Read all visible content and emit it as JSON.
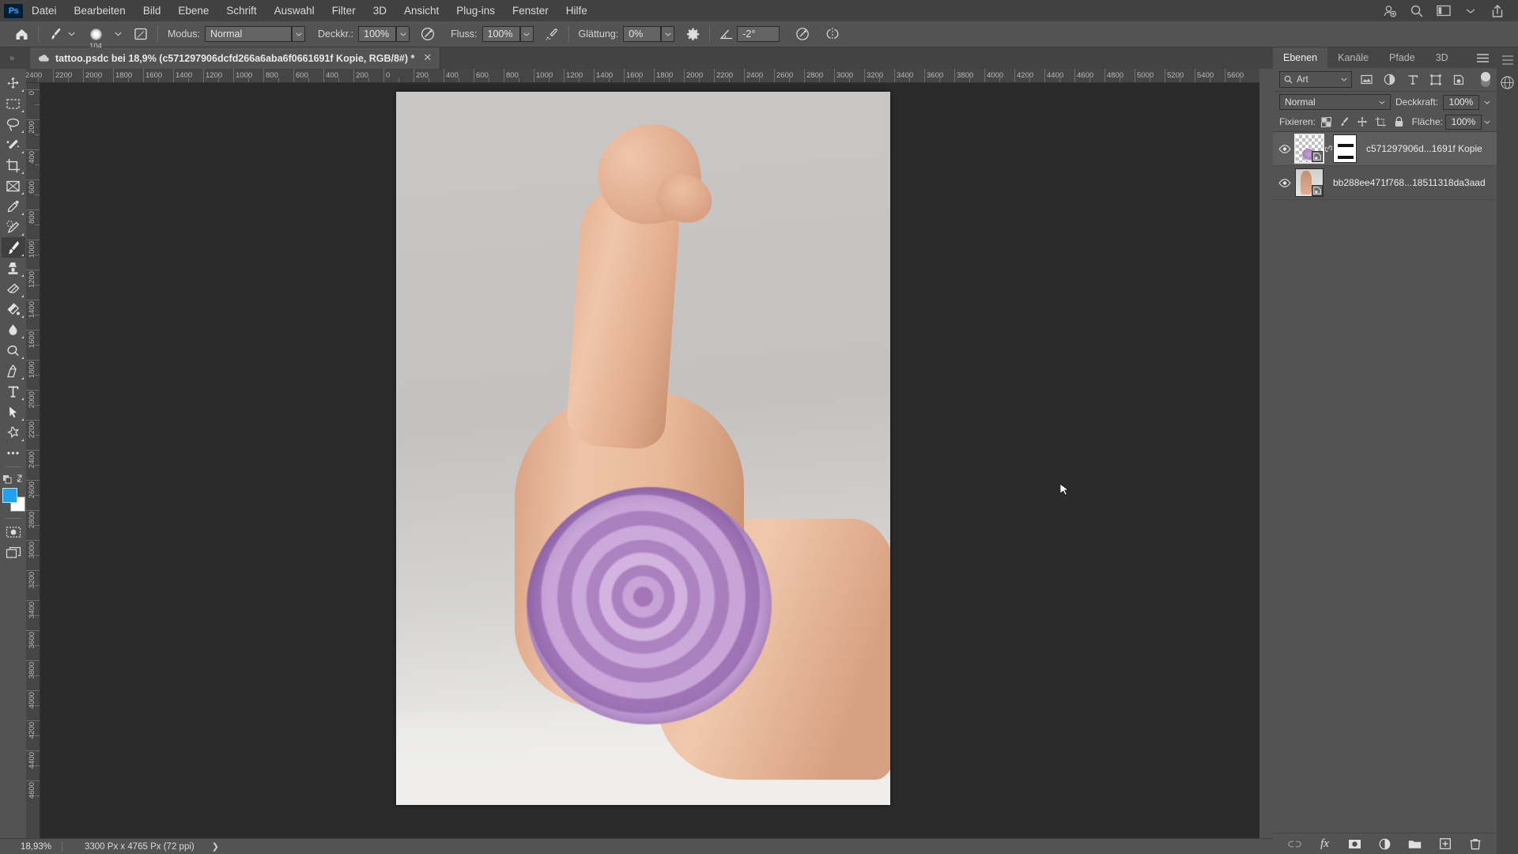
{
  "app": {
    "logo": "Ps"
  },
  "menubar": {
    "items": [
      {
        "label": "Datei"
      },
      {
        "label": "Bearbeiten"
      },
      {
        "label": "Bild"
      },
      {
        "label": "Ebene"
      },
      {
        "label": "Schrift"
      },
      {
        "label": "Auswahl"
      },
      {
        "label": "Filter"
      },
      {
        "label": "3D"
      },
      {
        "label": "Ansicht"
      },
      {
        "label": "Plug-ins"
      },
      {
        "label": "Fenster"
      },
      {
        "label": "Hilfe"
      }
    ],
    "right_icons": [
      "user-add-icon",
      "search-icon",
      "workspace-icon",
      "chevron-down-icon",
      "share-icon"
    ]
  },
  "options_bar": {
    "home_icon": "home-icon",
    "tool_icon": "brush-tool-icon",
    "brush_size": "104",
    "brush_panel_icon": "brush-settings-icon",
    "mode_label": "Modus:",
    "mode_value": "Normal",
    "opacity_label": "Deckkr.:",
    "opacity_value": "100%",
    "pressure_opacity_icon": "pressure-opacity-icon",
    "flow_label": "Fluss:",
    "flow_value": "100%",
    "airbrush_icon": "airbrush-icon",
    "smoothing_label": "Glättung:",
    "smoothing_value": "0%",
    "smoothing_gear_icon": "gear-icon",
    "angle_icon": "angle-icon",
    "angle_value": "-2°",
    "pressure_size_icon": "pressure-size-icon",
    "symmetry_icon": "symmetry-icon"
  },
  "document_tab": {
    "cloud_icon": "cloud-icon",
    "title": "tattoo.psdc bei 18,9% (c571297906dcfd266a6aba6f0661691f Kopie, RGB/8#) *",
    "close_icon": "close-icon",
    "expander_icon": "expand-panels-icon"
  },
  "toolbar": {
    "tools": [
      {
        "name": "move-tool",
        "active": false
      },
      {
        "name": "rectangular-marquee-tool",
        "active": false
      },
      {
        "name": "lasso-tool",
        "active": false
      },
      {
        "name": "magic-wand-tool",
        "active": false
      },
      {
        "name": "crop-tool",
        "active": false
      },
      {
        "name": "frame-tool",
        "active": false
      },
      {
        "name": "eyedropper-tool",
        "active": false
      },
      {
        "name": "spot-healing-brush-tool",
        "active": false
      },
      {
        "name": "brush-tool",
        "active": true
      },
      {
        "name": "clone-stamp-tool",
        "active": false
      },
      {
        "name": "eraser-tool",
        "active": false
      },
      {
        "name": "gradient-tool",
        "active": false
      },
      {
        "name": "blur-tool",
        "active": false
      },
      {
        "name": "dodge-tool",
        "active": false
      },
      {
        "name": "pen-tool",
        "active": false
      },
      {
        "name": "type-tool",
        "active": false
      },
      {
        "name": "path-selection-tool",
        "active": false
      },
      {
        "name": "custom-shape-tool",
        "active": false
      },
      {
        "name": "more-tools",
        "active": false
      }
    ],
    "swap_colors_icon": "swap-colors-icon",
    "default_colors_icon": "default-colors-icon",
    "foreground_color": "#1ca2f0",
    "background_color": "#ffffff",
    "quickmask_icon": "quick-mask-icon",
    "screenmode_icon": "screen-mode-icon"
  },
  "rulers": {
    "unit": "px",
    "horizontal_labels": [
      "2400",
      "2200",
      "2000",
      "1800",
      "1600",
      "1400",
      "1200",
      "1000",
      "800",
      "600",
      "400",
      "200",
      "0",
      "200",
      "400",
      "600",
      "800",
      "1000",
      "1200",
      "1400",
      "1600",
      "1800",
      "2000",
      "2200",
      "2400",
      "2600",
      "2800",
      "3000",
      "3200",
      "3400",
      "3600",
      "3800",
      "4000",
      "4200",
      "4400",
      "4600",
      "4800",
      "5000",
      "5200",
      "5400",
      "5600"
    ],
    "vertical_labels": [
      "0",
      "200",
      "400",
      "600",
      "800",
      "1000",
      "1200",
      "1400",
      "1600",
      "1800",
      "2000",
      "2200",
      "2400",
      "2600",
      "2800",
      "3000",
      "3200",
      "3400",
      "3600",
      "3800",
      "4000",
      "4200",
      "4400",
      "4600"
    ]
  },
  "panels": {
    "tabs": [
      {
        "label": "Ebenen",
        "active": true
      },
      {
        "label": "Kanäle",
        "active": false
      },
      {
        "label": "Pfade",
        "active": false
      },
      {
        "label": "3D",
        "active": false
      }
    ],
    "menu_icon": "panel-menu-icon",
    "filter": {
      "search_icon": "search-icon",
      "kind_label": "Art",
      "caret_icon": "chevron-down-icon",
      "icons": [
        "pixel-layer-filter-icon",
        "adjustment-layer-filter-icon",
        "type-layer-filter-icon",
        "shape-layer-filter-icon",
        "smart-object-filter-icon"
      ],
      "toggle_icon": "filter-toggle-switch"
    },
    "blend": {
      "mode_value": "Normal",
      "mode_caret": "chevron-down-icon",
      "opacity_label": "Deckkraft:",
      "opacity_value": "100%",
      "opacity_caret": "chevron-down-icon"
    },
    "lock": {
      "label": "Fixieren:",
      "icons": [
        "lock-transparent-pixels-icon",
        "lock-image-pixels-icon",
        "lock-position-icon",
        "lock-artboard-nesting-icon",
        "lock-all-icon"
      ],
      "fill_label": "Fläche:",
      "fill_value": "100%",
      "fill_caret": "chevron-down-icon"
    },
    "layers": [
      {
        "visible_icon": "eye-icon",
        "name": "c571297906d...1691f Kopie",
        "selected": true,
        "has_mask": true,
        "link_icon": "link-icon",
        "thumb_kind": "transparent-with-rose",
        "smart_object_badge": "smart-object-badge-icon"
      },
      {
        "visible_icon": "eye-icon",
        "name": "bb288ee471f768...18511318da3aad",
        "selected": false,
        "has_mask": false,
        "thumb_kind": "arm-photo",
        "smart_object_badge": "smart-object-badge-icon"
      }
    ],
    "footer_icons": [
      "link-layers-icon",
      "fx-icon",
      "add-layer-mask-icon",
      "new-adjustment-layer-icon",
      "new-group-icon",
      "new-layer-icon",
      "delete-layer-icon"
    ],
    "footer_fx_label": "fx"
  },
  "right_strip": {
    "icons": [
      "collapse-panels-icon",
      "3d-sphere-icon"
    ]
  },
  "statusbar": {
    "zoom": "18,93%",
    "dimensions": "3300 Px x 4765 Px (72 ppi)",
    "arrow_icon": "chevron-right-icon"
  },
  "canvas": {
    "document_name": "tattoo.psdc",
    "zoom_level": "18,93%",
    "artwork_description": "flexed arm with purple rose tattoo on biceps"
  },
  "colors": {
    "app_bg": "#535353",
    "menu_bg": "#414141",
    "canvas_bg": "#2b2b2b",
    "panel_bg": "#535353",
    "accent": "#31a8ff",
    "foreground_swatch": "#1ca2f0"
  },
  "cursor": {
    "icon": "mouse-pointer-icon"
  }
}
